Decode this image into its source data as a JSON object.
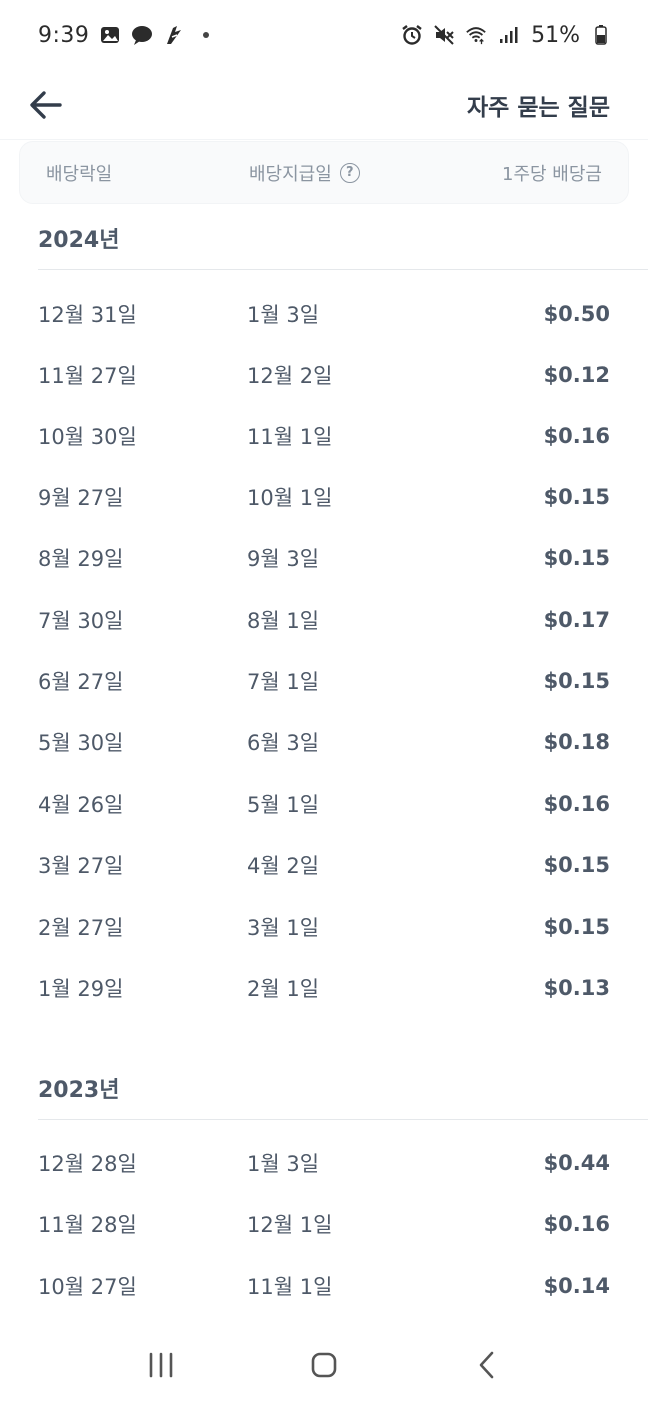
{
  "status_bar": {
    "time": "9:39",
    "battery": "51%",
    "left_icons": [
      "gallery-icon",
      "chat-bubble-icon",
      "app-notification-icon"
    ],
    "right_icons": [
      "alarm-icon",
      "mute-icon",
      "wifi-icon",
      "signal-icon",
      "battery-icon"
    ]
  },
  "header": {
    "faq_label": "자주 묻는 질문"
  },
  "columns": {
    "ex_date": "배당락일",
    "pay_date": "배당지급일",
    "help": "?",
    "amount": "1주당 배당금"
  },
  "years": [
    {
      "label": "2024년",
      "rows": [
        {
          "ex": "12월 31일",
          "pay": "1월 3일",
          "amount": "$0.50"
        },
        {
          "ex": "11월 27일",
          "pay": "12월 2일",
          "amount": "$0.12"
        },
        {
          "ex": "10월 30일",
          "pay": "11월 1일",
          "amount": "$0.16"
        },
        {
          "ex": "9월 27일",
          "pay": "10월 1일",
          "amount": "$0.15"
        },
        {
          "ex": "8월 29일",
          "pay": "9월 3일",
          "amount": "$0.15"
        },
        {
          "ex": "7월 30일",
          "pay": "8월 1일",
          "amount": "$0.17"
        },
        {
          "ex": "6월 27일",
          "pay": "7월 1일",
          "amount": "$0.15"
        },
        {
          "ex": "5월 30일",
          "pay": "6월 3일",
          "amount": "$0.18"
        },
        {
          "ex": "4월 26일",
          "pay": "5월 1일",
          "amount": "$0.16"
        },
        {
          "ex": "3월 27일",
          "pay": "4월 2일",
          "amount": "$0.15"
        },
        {
          "ex": "2월 27일",
          "pay": "3월 1일",
          "amount": "$0.15"
        },
        {
          "ex": "1월 29일",
          "pay": "2월 1일",
          "amount": "$0.13"
        }
      ]
    },
    {
      "label": "2023년",
      "rows": [
        {
          "ex": "12월 28일",
          "pay": "1월 3일",
          "amount": "$0.44"
        },
        {
          "ex": "11월 28일",
          "pay": "12월 1일",
          "amount": "$0.16"
        },
        {
          "ex": "10월 27일",
          "pay": "11월 1일",
          "amount": "$0.14"
        }
      ]
    }
  ],
  "nav_bar": {
    "buttons": [
      "recent-apps-button",
      "home-button",
      "back-nav-button"
    ]
  }
}
